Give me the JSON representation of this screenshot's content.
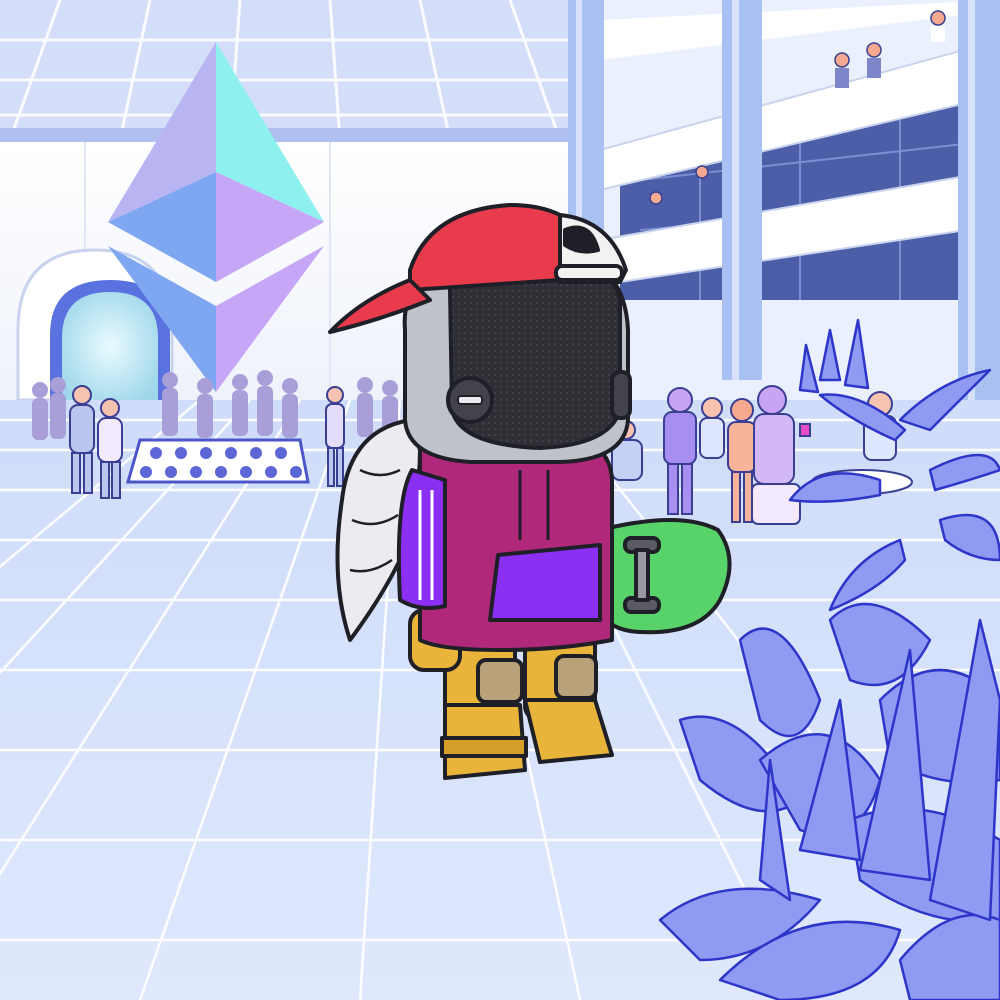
{
  "scene": {
    "subject": "robot-mascot",
    "palette": {
      "floor": "#d6e3fb",
      "floor_grid": "#ffffff",
      "wall": "#f4f6fc",
      "ceiling": "#c9d7f7",
      "column": "#a9c1f2",
      "ether_top_left": "#b9b5f3",
      "ether_top_right": "#8ff1ef",
      "ether_bottom_left": "#7fa6f0",
      "ether_bottom_right": "#c6a6f6",
      "crowd": "#a89fd8",
      "plant": "#8f9af2",
      "plant_outline": "#2d36c9",
      "cap_red": "#e83b4c",
      "cap_white": "#f2f2f2",
      "hoodie_magenta": "#b0287a",
      "hoodie_purple": "#8b2ff2",
      "pants_gold": "#e8b43a",
      "skateboard_green": "#58d36a",
      "helmet_gray": "#bfc3c9",
      "visor_dark": "#2f2f36",
      "wing_white": "#ececf0"
    },
    "icons": [
      "ethereum-logo-icon"
    ]
  }
}
